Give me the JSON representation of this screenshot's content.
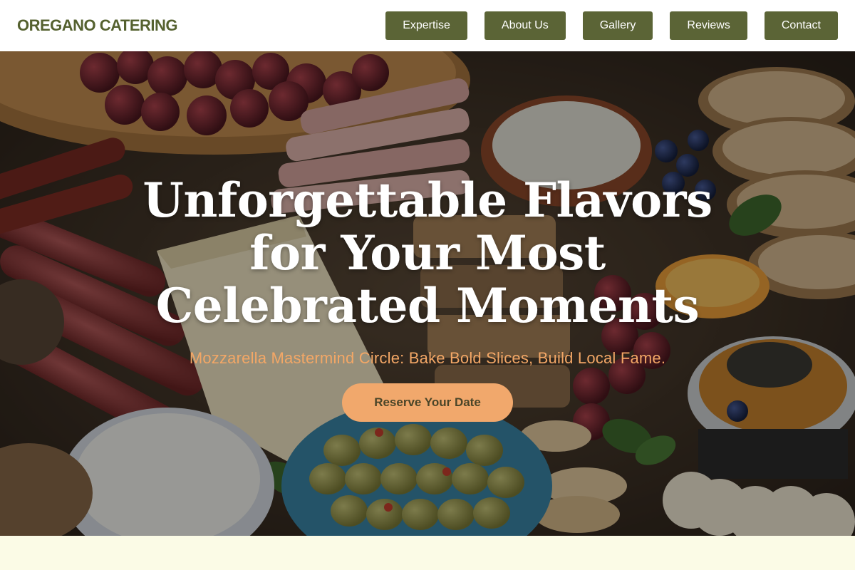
{
  "header": {
    "brand": "OREGANO CATERING",
    "nav": [
      {
        "label": "Expertise"
      },
      {
        "label": "About Us"
      },
      {
        "label": "Gallery"
      },
      {
        "label": "Reviews"
      },
      {
        "label": "Contact"
      }
    ]
  },
  "hero": {
    "title": "Unforgettable Flavors for Your Most Celebrated Moments",
    "subtitle": "Mozzarella Mastermind Circle: Bake Bold Slices, Build Local Fame.",
    "cta_label": "Reserve Your Date"
  },
  "colors": {
    "brand_text": "#55612f",
    "nav_button": "#5b6436",
    "subtitle": "#f3a766",
    "cta_background": "#f1a86c",
    "section_background": "#fbfbe6"
  }
}
